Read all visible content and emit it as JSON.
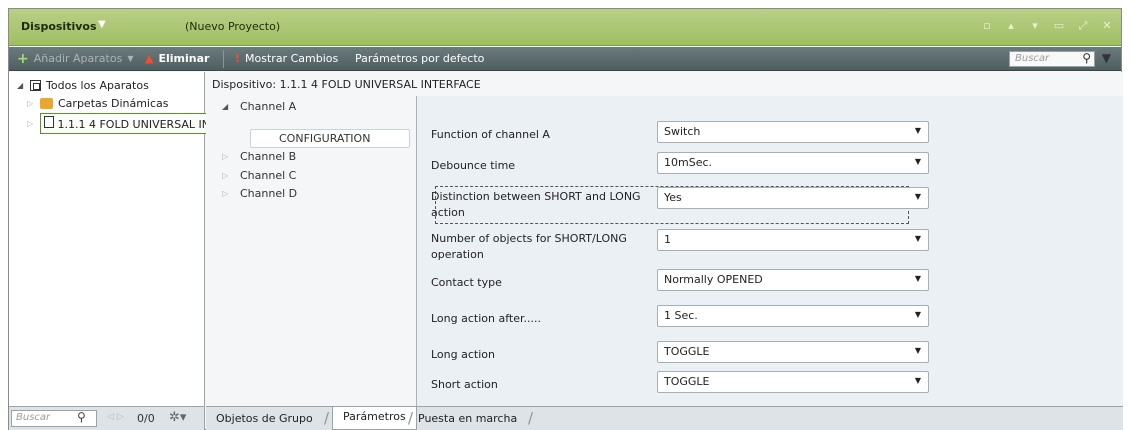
{
  "titlebar": {
    "title": "Dispositivos",
    "title_arrow": "▼",
    "project": "(Nuevo Proyecto)",
    "window_icons": [
      "▫",
      "▴",
      "▾",
      "▭",
      "⤢",
      "✕"
    ]
  },
  "toolbar": {
    "add_devices": "Añadir Aparatos",
    "add_devices_arrow": "▼",
    "delete": "Eliminar",
    "show_changes": "Mostrar Cambios",
    "default_params": "Parámetros por defecto",
    "search_placeholder": "Buscar"
  },
  "tree": {
    "root": "Todos los Aparatos",
    "dynamic_folders": "Carpetas Dinámicas",
    "device": "1.1.1  4 FOLD UNIVERSAL IN..."
  },
  "left_bottom": {
    "search_placeholder": "Buscar",
    "count": "0/0"
  },
  "device_header": "Dispositivo: 1.1.1  4 FOLD UNIVERSAL INTERFACE",
  "channels": {
    "channel_a": "Channel A",
    "configuration": "CONFIGURATION",
    "channel_b": "Channel B",
    "channel_c": "Channel C",
    "channel_d": "Channel D"
  },
  "params": [
    {
      "label": "Function of channel A",
      "value": "Switch"
    },
    {
      "label": "Debounce time",
      "value": "10mSec."
    },
    {
      "label": "Distinction between SHORT and LONG action",
      "value": "Yes"
    },
    {
      "label": "Number of objects for SHORT/LONG operation",
      "value": "1"
    },
    {
      "label": "Contact type",
      "value": "Normally OPENED"
    },
    {
      "label": "Long action after.....",
      "value": "1 Sec."
    },
    {
      "label": "Long action",
      "value": "TOGGLE"
    },
    {
      "label": "Short action",
      "value": "TOGGLE"
    }
  ],
  "bottom_tabs": {
    "group_objects": "Objetos de Grupo",
    "parameters": "Parámetros",
    "commissioning": "Puesta en marcha"
  },
  "colors": {
    "titlebar": "#9fbf63",
    "toolbar": "#5a696c",
    "params_bg": "#ebf0f4",
    "selection_border": "#5e8f2e"
  }
}
